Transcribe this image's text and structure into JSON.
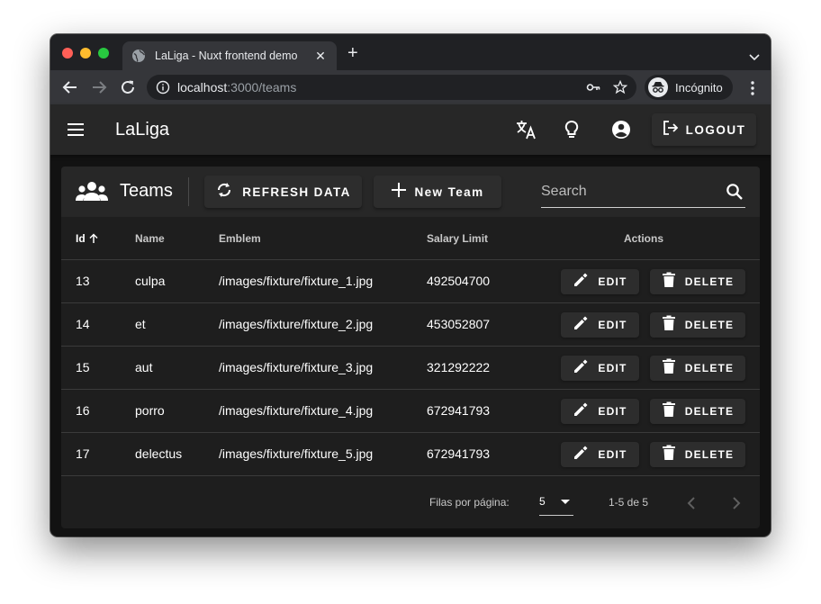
{
  "browser": {
    "tab_title": "LaLiga - Nuxt frontend demo",
    "url_host": "localhost",
    "url_rest": ":3000/teams",
    "incognito_label": "Incógnito"
  },
  "appbar": {
    "title": "LaLiga",
    "logout_label": "LOGOUT"
  },
  "toolbar": {
    "title": "Teams",
    "refresh_label": "REFRESH DATA",
    "new_label": "New Team",
    "search_placeholder": "Search"
  },
  "table": {
    "headers": {
      "id": "Id",
      "name": "Name",
      "emblem": "Emblem",
      "salary": "Salary Limit",
      "actions": "Actions"
    },
    "edit_label": "EDIT",
    "delete_label": "DELETE",
    "rows": [
      {
        "id": "13",
        "name": "culpa",
        "emblem": "/images/fixture/fixture_1.jpg",
        "salary": "492504700"
      },
      {
        "id": "14",
        "name": "et",
        "emblem": "/images/fixture/fixture_2.jpg",
        "salary": "453052807"
      },
      {
        "id": "15",
        "name": "aut",
        "emblem": "/images/fixture/fixture_3.jpg",
        "salary": "321292222"
      },
      {
        "id": "16",
        "name": "porro",
        "emblem": "/images/fixture/fixture_4.jpg",
        "salary": "672941793"
      },
      {
        "id": "17",
        "name": "delectus",
        "emblem": "/images/fixture/fixture_5.jpg",
        "salary": "672941793"
      }
    ]
  },
  "footer": {
    "rows_per_page_label": "Filas por página:",
    "rows_per_page_value": "5",
    "range_text": "1-5 de 5"
  },
  "icons": {
    "tab_favicon": "globe-icon",
    "sort": "arrow-up-icon",
    "team": "group-icon",
    "refresh": "refresh-icon",
    "add": "plus-icon",
    "search": "search-icon",
    "edit": "pencil-icon",
    "delete": "trash-icon"
  },
  "colors": {
    "surface": "#1e1e1e",
    "appbar": "#272727",
    "button": "#2d2d2d",
    "text": "#ffffff"
  }
}
